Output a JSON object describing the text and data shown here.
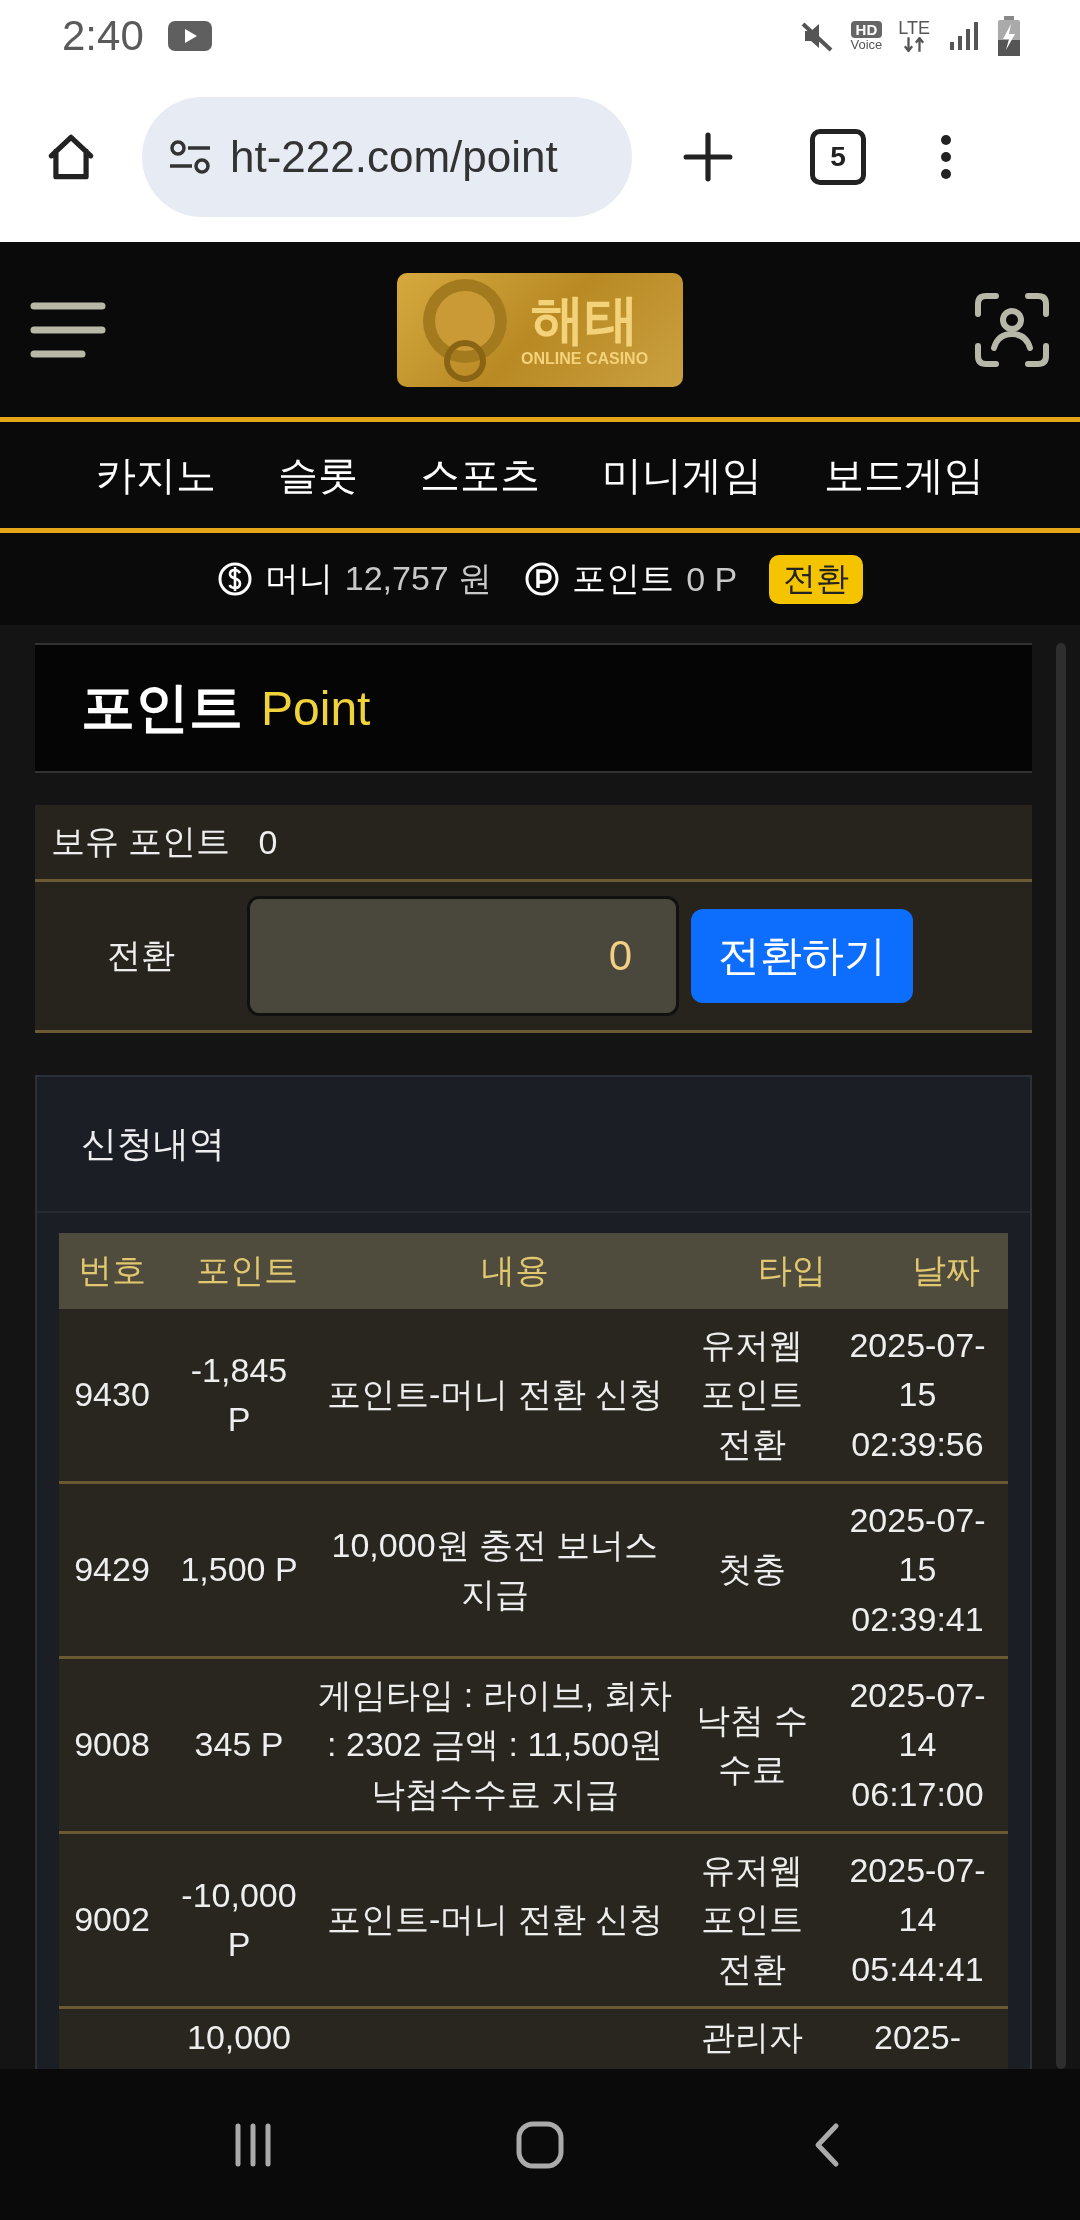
{
  "status_bar": {
    "time": "2:40",
    "hd": "HD",
    "voice": "Voice",
    "network": "LTE"
  },
  "browser": {
    "url": "ht-222.com/point",
    "tab_count": "5"
  },
  "header": {
    "logo_title": "해태",
    "logo_subtitle": "ONLINE CASINO"
  },
  "nav": [
    "카지노",
    "슬롯",
    "스포츠",
    "미니게임",
    "보드게임"
  ],
  "balance": {
    "money_label": "머니",
    "money_value": "12,757 원",
    "point_label": "포인트",
    "point_value": "0 P",
    "convert_button": "전환"
  },
  "page_title": {
    "ko": "포인트",
    "en": "Point"
  },
  "holding": {
    "label": "보유 포인트",
    "value": "0"
  },
  "convert": {
    "label": "전환",
    "value": "0",
    "button": "전환하기"
  },
  "history": {
    "title": "신청내역",
    "columns": [
      "번호",
      "포인트",
      "내용",
      "타입",
      "날짜"
    ],
    "rows": [
      {
        "no": "9430",
        "points": "-1,845 P",
        "content": "포인트-머니 전환 신청",
        "type": "유저웹 포인트 전환",
        "date": "2025-07-15 02:39:56"
      },
      {
        "no": "9429",
        "points": "1,500 P",
        "content": "10,000원 충전 보너스 지급",
        "type": "첫충",
        "date": "2025-07-15 02:39:41"
      },
      {
        "no": "9008",
        "points": "345 P",
        "content": "게임타입 : 라이브, 회차 : 2302 금액 : 11,500원 낙첨수수료 지급",
        "type": "낙첨 수 수료",
        "date": "2025-07-14 06:17:00"
      },
      {
        "no": "9002",
        "points": "-10,000 P",
        "content": "포인트-머니 전환 신청",
        "type": "유저웹 포인트 전환",
        "date": "2025-07-14 05:44:41"
      },
      {
        "points": "10,000",
        "type": "관리자",
        "date": "2025-"
      }
    ]
  }
}
